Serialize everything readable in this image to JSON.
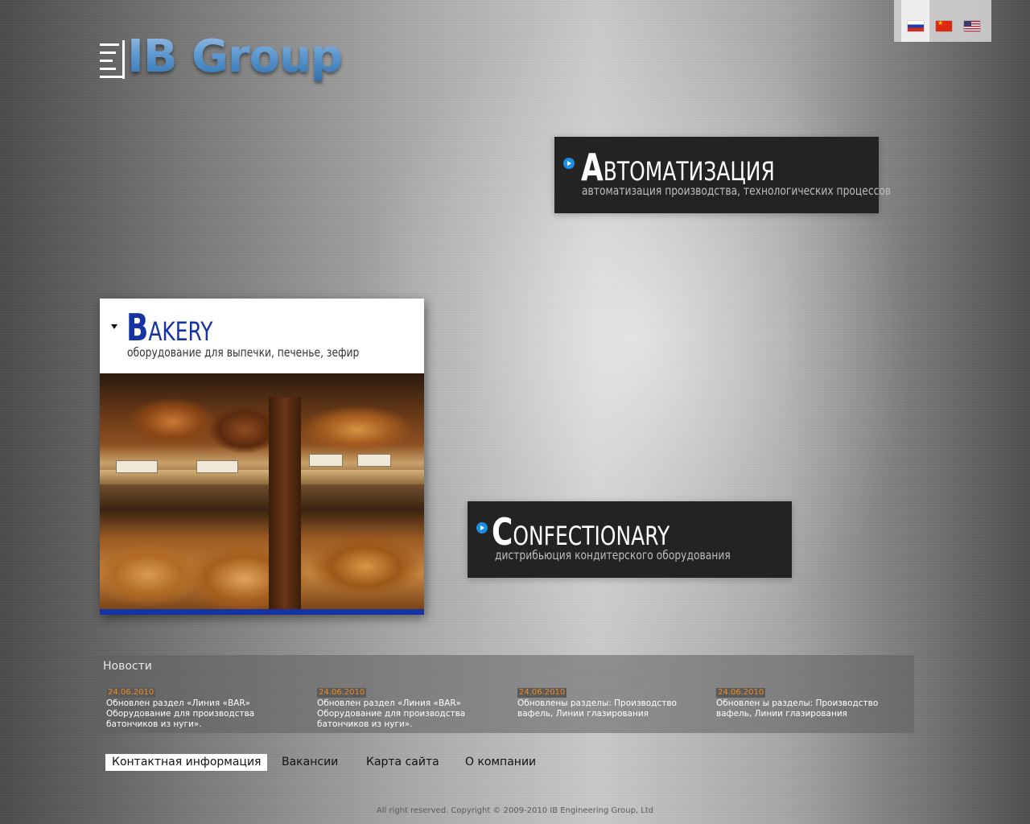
{
  "logo": {
    "text": "IB Group"
  },
  "languages": [
    {
      "name": "Russian",
      "icon": "flag-ru-icon",
      "active": true
    },
    {
      "name": "Chinese",
      "icon": "flag-cn-icon",
      "active": false
    },
    {
      "name": "English",
      "icon": "flag-us-icon",
      "active": false
    }
  ],
  "categories": {
    "automation": {
      "title_first": "А",
      "title_rest": "ВТОМАТИЗАЦИЯ",
      "subtitle": "автоматизация производства, технологических процессов"
    },
    "bakery": {
      "title_first": "B",
      "title_rest": "AKERY",
      "subtitle": "оборудование для выпечки, печенье, зефир",
      "image": "bakery-display-photo"
    },
    "confectionary": {
      "title_first": "C",
      "title_rest": "ONFECTIONARY",
      "subtitle": "дистрибьюция кондитерского оборудования"
    }
  },
  "news": {
    "title": "Новости",
    "items": [
      {
        "date": "24.06.2010",
        "text": "Обновлен раздел «Линия «BAR» Оборудование для производства батончиков из нуги»."
      },
      {
        "date": "24.06.2010",
        "text": "Обновлен раздел «Линия «BAR» Оборудование для производства батончиков из нуги»."
      },
      {
        "date": "24.06.2010",
        "text": "Обновлены разделы: Производство вафель, Линии глазирования"
      },
      {
        "date": "24.06.2010",
        "text": "Обновлен ы разделы: Производство вафель, Линии глазирования"
      }
    ]
  },
  "footer_nav": [
    {
      "label": "Контактная информация",
      "active": true
    },
    {
      "label": "Вакансии",
      "active": false
    },
    {
      "label": "Карта сайта",
      "active": false
    },
    {
      "label": "О компании",
      "active": false
    }
  ],
  "copyright": "All right reserved. Copyright © 2009-2010 IB Engineering Group, Ltd",
  "colors": {
    "accent_blue": "#1533a3",
    "link_blue": "#1d8fe0",
    "news_date": "#f08a1e"
  }
}
